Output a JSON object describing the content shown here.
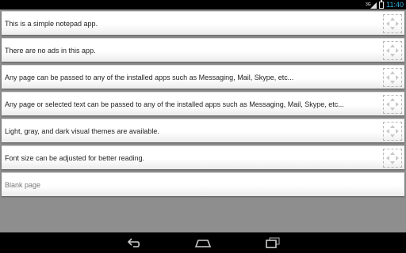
{
  "status_bar": {
    "network": "3G",
    "time": "11:40"
  },
  "notes": [
    {
      "text": "This is a simple notepad app."
    },
    {
      "text": "There are no ads in this app."
    },
    {
      "text": "Any page can be passed to any of the installed apps such as Messaging, Mail, Skype, etc..."
    },
    {
      "text": "Any page or selected text can be passed to any of the installed apps such as Messaging, Mail, Skype, etc..."
    },
    {
      "text": "Light, gray, and dark visual themes are available."
    },
    {
      "text": "Font size can be adjusted for better reading."
    }
  ],
  "new_page": {
    "placeholder": "Blank page"
  },
  "icons": {
    "drag_handle": "drag-handle-icon",
    "back": "back-icon",
    "home": "home-icon",
    "recents": "recent-apps-icon"
  },
  "colors": {
    "clock": "#33b5e5",
    "background": "#8e8e8e",
    "row": "#ffffff"
  }
}
